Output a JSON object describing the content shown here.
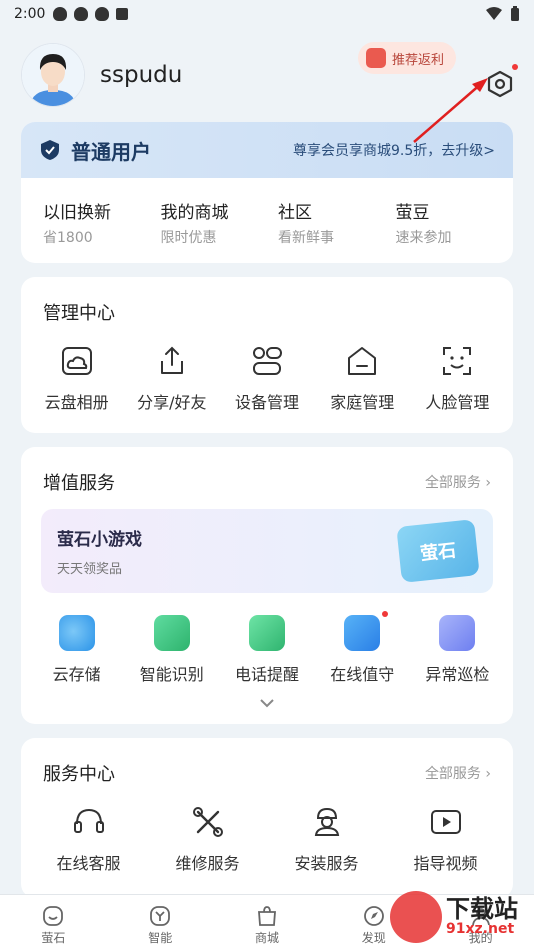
{
  "status": {
    "time": "2:00"
  },
  "profile": {
    "username": "sspudu"
  },
  "promo": {
    "label": "推荐返利"
  },
  "vip": {
    "title": "普通用户",
    "upgrade": "尊享会员享商城9.5折，去升级>"
  },
  "quick": [
    {
      "title": "以旧换新",
      "sub": "省1800"
    },
    {
      "title": "我的商城",
      "sub": "限时优惠"
    },
    {
      "title": "社区",
      "sub": "看新鲜事"
    },
    {
      "title": "萤豆",
      "sub": "速来参加"
    }
  ],
  "manage": {
    "title": "管理中心",
    "items": [
      {
        "label": "云盘相册",
        "icon": "cloud-album-icon"
      },
      {
        "label": "分享/好友",
        "icon": "share-icon"
      },
      {
        "label": "设备管理",
        "icon": "device-icon"
      },
      {
        "label": "家庭管理",
        "icon": "home-icon"
      },
      {
        "label": "人脸管理",
        "icon": "face-icon"
      }
    ]
  },
  "value": {
    "title": "增值服务",
    "more": "全部服务",
    "game_title": "萤石小游戏",
    "game_sub": "天天领奖品",
    "game_logo": "萤石",
    "items": [
      {
        "label": "云存储",
        "icon": "cloud-storage-icon",
        "color": "#3aa6ef"
      },
      {
        "label": "智能识别",
        "icon": "ai-icon",
        "color": "#3cc47c"
      },
      {
        "label": "电话提醒",
        "icon": "phone-alert-icon",
        "color": "#35c07a"
      },
      {
        "label": "在线值守",
        "icon": "guard-icon",
        "color": "#2f8ff0"
      },
      {
        "label": "异常巡检",
        "icon": "inspect-icon",
        "color": "#7a8cf0"
      }
    ]
  },
  "service": {
    "title": "服务中心",
    "more": "全部服务",
    "items": [
      {
        "label": "在线客服",
        "icon": "headset-icon"
      },
      {
        "label": "维修服务",
        "icon": "wrench-icon"
      },
      {
        "label": "安装服务",
        "icon": "installer-icon"
      },
      {
        "label": "指导视频",
        "icon": "video-icon"
      }
    ]
  },
  "nav": [
    {
      "label": "萤石",
      "icon": "ezviz-icon"
    },
    {
      "label": "智能",
      "icon": "smart-icon"
    },
    {
      "label": "商城",
      "icon": "shop-icon"
    },
    {
      "label": "发现",
      "icon": "discover-icon"
    },
    {
      "label": "我的",
      "icon": "me-icon"
    }
  ],
  "watermark": {
    "text": "下载站",
    "url": "91xz.net"
  }
}
